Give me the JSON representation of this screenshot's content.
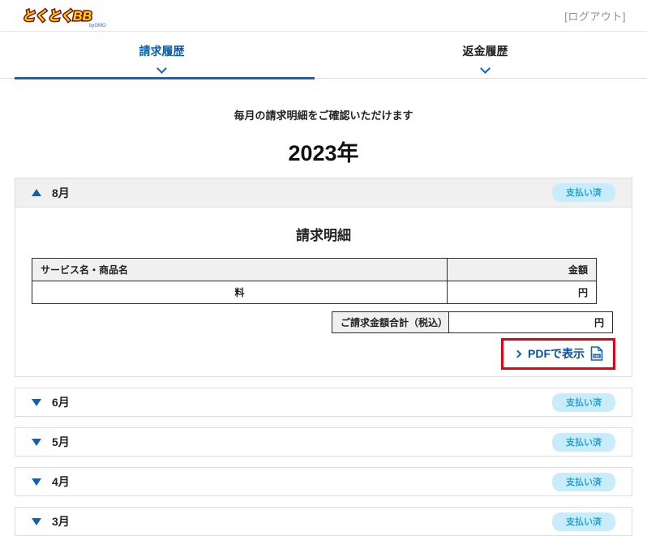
{
  "header": {
    "logo_text": "とくとくBB",
    "logo_sub": "byGMO",
    "logout_label": "[ログアウト]"
  },
  "tabs": [
    {
      "label": "請求履歴",
      "active": true
    },
    {
      "label": "返金履歴",
      "active": false
    }
  ],
  "intro_text": "毎月の請求明細をご確認いただけます",
  "year_title": "2023年",
  "expanded_panel": {
    "month": "8月",
    "status": "支払い済",
    "detail_title": "請求明細",
    "table": {
      "headers": [
        "サービス名・商品名",
        "金額"
      ],
      "rows": [
        [
          "料",
          "円"
        ]
      ]
    },
    "total_label": "ご請求金額合計（税込）",
    "total_value": "円",
    "pdf_link_label": "PDFで表示"
  },
  "collapsed_panels": [
    {
      "month": "6月",
      "status": "支払い済"
    },
    {
      "month": "5月",
      "status": "支払い済"
    },
    {
      "month": "4月",
      "status": "支払い済"
    },
    {
      "month": "3月",
      "status": "支払い済"
    }
  ],
  "icons": {
    "expanded_marker": "triangle-up",
    "collapsed_marker": "triangle-down",
    "tab_marker": "chevron-down",
    "pdf_icon": "pdf-file"
  },
  "colors": {
    "accent_blue": "#1565c0",
    "link_blue": "#0a4f9e",
    "badge_bg": "#c9ecfb",
    "badge_text": "#1fa3dc",
    "highlight_red": "#e60012",
    "panel_header_bg": "#f0f0f0"
  }
}
